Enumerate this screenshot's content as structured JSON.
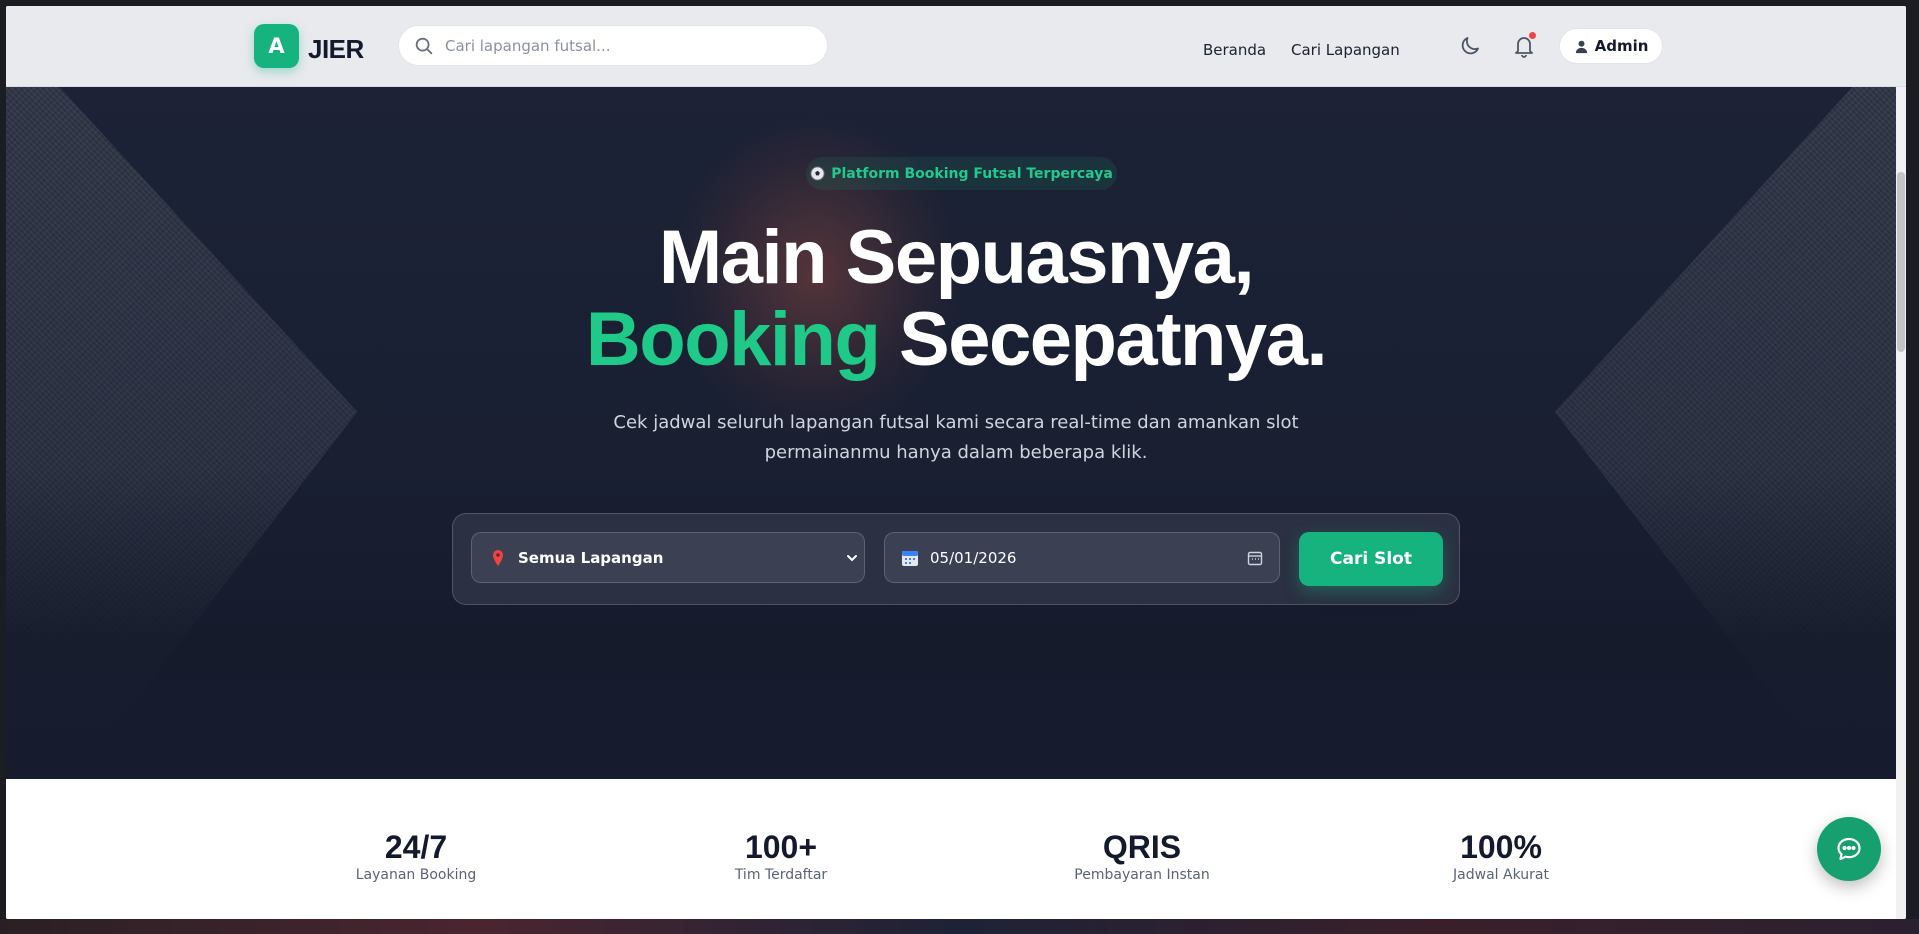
{
  "navbar": {
    "logo_letter": "A",
    "brand": "JIER",
    "search_placeholder": "Cari lapangan futsal...",
    "links": [
      "Beranda",
      "Cari Lapangan"
    ],
    "user_label": "Admin",
    "notification_dot_color": "#ef4444"
  },
  "hero": {
    "badge": "Platform Booking Futsal Terpercaya",
    "headline_line1": "Main Sepuasnya,",
    "headline_accent": "Booking",
    "headline_line2_rest": " Secepatnya.",
    "subtext": "Cek jadwal seluruh lapangan futsal kami secara real-time dan amankan slot permainanmu hanya dalam beberapa klik.",
    "field_select": "Semua Lapangan",
    "date_value": "05/01/2026",
    "search_button": "Cari Slot"
  },
  "stats": [
    {
      "value": "24/7",
      "label": "Layanan Booking"
    },
    {
      "value": "100+",
      "label": "Tim Terdaftar"
    },
    {
      "value": "QRIS",
      "label": "Pembayaran Instan"
    },
    {
      "value": "100%",
      "label": "Jadwal Akurat"
    }
  ],
  "colors": {
    "accent": "#16b37e",
    "accent_text": "#1fc987",
    "navy": "#131a2e"
  },
  "icons": [
    "search-icon",
    "moon-icon",
    "bell-icon",
    "user-icon",
    "soccer-ball-icon",
    "map-pin-icon",
    "chevron-down-icon",
    "calendar-icon",
    "chat-icon"
  ]
}
